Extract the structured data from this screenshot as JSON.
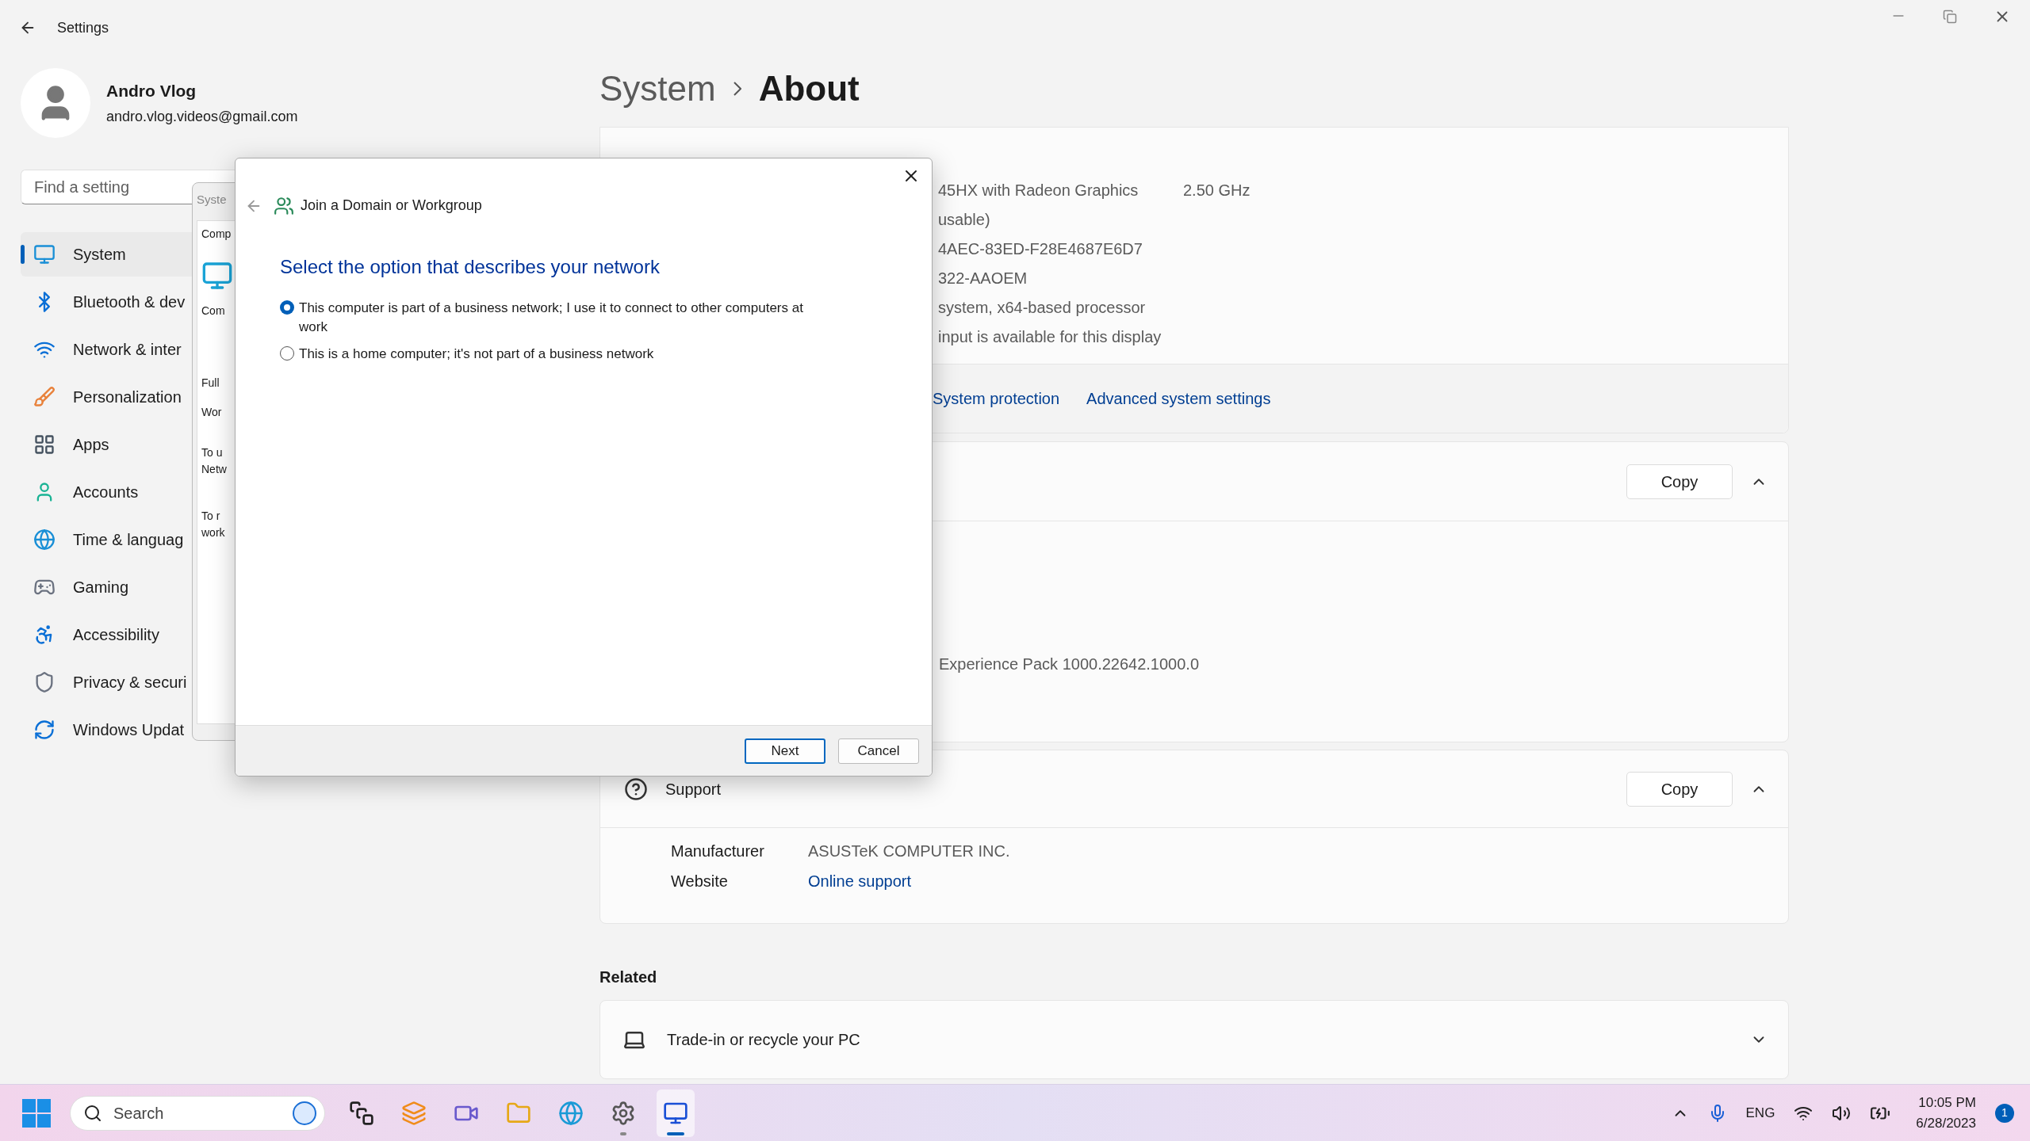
{
  "titlebar": {
    "title": "Settings"
  },
  "profile": {
    "name": "Andro Vlog",
    "email": "andro.vlog.videos@gmail.com"
  },
  "search": {
    "placeholder": "Find a setting"
  },
  "nav": [
    {
      "label": "System",
      "selected": true
    },
    {
      "label": "Bluetooth & dev",
      "selected": false
    },
    {
      "label": "Network & inter",
      "selected": false
    },
    {
      "label": "Personalization",
      "selected": false
    },
    {
      "label": "Apps",
      "selected": false
    },
    {
      "label": "Accounts",
      "selected": false
    },
    {
      "label": "Time & languag",
      "selected": false
    },
    {
      "label": "Gaming",
      "selected": false
    },
    {
      "label": "Accessibility",
      "selected": false
    },
    {
      "label": "Privacy & securi",
      "selected": false
    },
    {
      "label": "Windows Updat",
      "selected": false
    }
  ],
  "breadcrumb": {
    "parent": "System",
    "current": "About"
  },
  "device_specs": {
    "rows": [
      {
        "value": "45HX with Radeon Graphics",
        "extra": "2.50 GHz"
      },
      {
        "value": "usable)"
      },
      {
        "value": "4AEC-83ED-F28E4687E6D7"
      },
      {
        "value": "322-AAOEM"
      },
      {
        "value": "system, x64-based processor"
      },
      {
        "value": "input is available for this display"
      }
    ],
    "links": [
      "System protection",
      "Advanced system settings"
    ]
  },
  "windows_specs": {
    "copy": "Copy",
    "expanded": true,
    "rows": [
      "Experience Pack 1000.22642.1000.0"
    ]
  },
  "support": {
    "title": "Support",
    "copy": "Copy",
    "expanded": true,
    "rows": [
      {
        "label": "Manufacturer",
        "value": "ASUSTeK COMPUTER INC.",
        "kind": "text"
      },
      {
        "label": "Website",
        "value": "Online support",
        "kind": "link"
      }
    ]
  },
  "related": {
    "title": "Related",
    "items": [
      {
        "label": "Trade-in or recycle your PC",
        "expanded": false
      }
    ]
  },
  "system_properties": {
    "title": "Syste",
    "tab": "Comp",
    "lines": [
      "Com",
      "Full",
      "Wor",
      "To u",
      "Netw",
      "To r",
      "work"
    ]
  },
  "dialog": {
    "title": "Join a Domain or Workgroup",
    "heading": "Select the option that describes your network",
    "options": [
      {
        "label": "This computer is part of a business network; I use it to connect to other computers at work",
        "selected": true
      },
      {
        "label": "This is a home computer; it's not part of a business network",
        "selected": false
      }
    ],
    "buttons": [
      {
        "label": "Next",
        "default": true
      },
      {
        "label": "Cancel",
        "default": false
      }
    ]
  },
  "taskbar": {
    "search_placeholder": "Search",
    "apps": [
      {
        "running": false,
        "selected": false
      },
      {
        "running": false,
        "selected": false
      },
      {
        "running": false,
        "selected": false
      },
      {
        "running": false,
        "selected": false
      },
      {
        "running": false,
        "selected": false
      },
      {
        "running": true,
        "selected": false
      },
      {
        "running": true,
        "selected": true
      }
    ]
  },
  "tray": {
    "language": "ENG",
    "time": "10:05 PM",
    "date": "6/28/2023",
    "notifications": "1"
  }
}
